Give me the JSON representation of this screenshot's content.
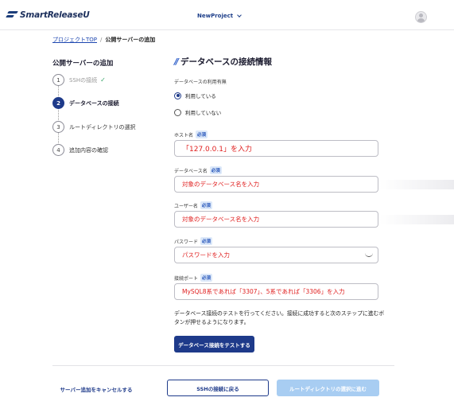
{
  "header": {
    "logo_text": "SmartReleaseU",
    "project_name": "NewProject"
  },
  "breadcrumb": {
    "root": "プロジェクトTOP",
    "separator": "/",
    "current": "公開サーバーの追加"
  },
  "steps": {
    "title": "公開サーバーの追加",
    "items": [
      {
        "num": "1",
        "label": "SSHの接続",
        "state": "done"
      },
      {
        "num": "2",
        "label": "データベースの接続",
        "state": "active"
      },
      {
        "num": "3",
        "label": "ルートディレクトリの選択",
        "state": "todo"
      },
      {
        "num": "4",
        "label": "追加内容の確認",
        "state": "todo"
      }
    ],
    "done_mark": "✓"
  },
  "form": {
    "title": "データベースの接続情報",
    "title_mark": "//",
    "usage_label": "データベースの利用有無",
    "usage_options": [
      "利用している",
      "利用していない"
    ],
    "usage_selected": "利用している",
    "required_badge": "必須",
    "fields": [
      {
        "label": "ホスト名",
        "placeholder": "「127.0.0.1」を入力"
      },
      {
        "label": "データベース名",
        "placeholder": "対象のデータベース名を入力"
      },
      {
        "label": "ユーザー名",
        "placeholder": "対象のデータベース名を入力"
      },
      {
        "label": "パスワード",
        "placeholder": "パスワードを入力"
      },
      {
        "label": "接続ポート",
        "placeholder": "MySQL8系であれば「3307」、5系であれば「3306」を入力"
      }
    ],
    "description": "データベース接続のテストを行ってください。接続に成功すると次のステップに進むボタンが押せるようになります。",
    "test_button": "データベース接続をテストする"
  },
  "footer": {
    "cancel": "サーバー追加をキャンセルする",
    "back": "SSHの接続に戻る",
    "next": "ルートディレクトリの選択に進む"
  },
  "colors": {
    "primary": "#1e3a8a",
    "placeholder_red": "#e02020",
    "disabled_button": "#a8cdf2",
    "required_badge_bg": "#dce8f9"
  }
}
